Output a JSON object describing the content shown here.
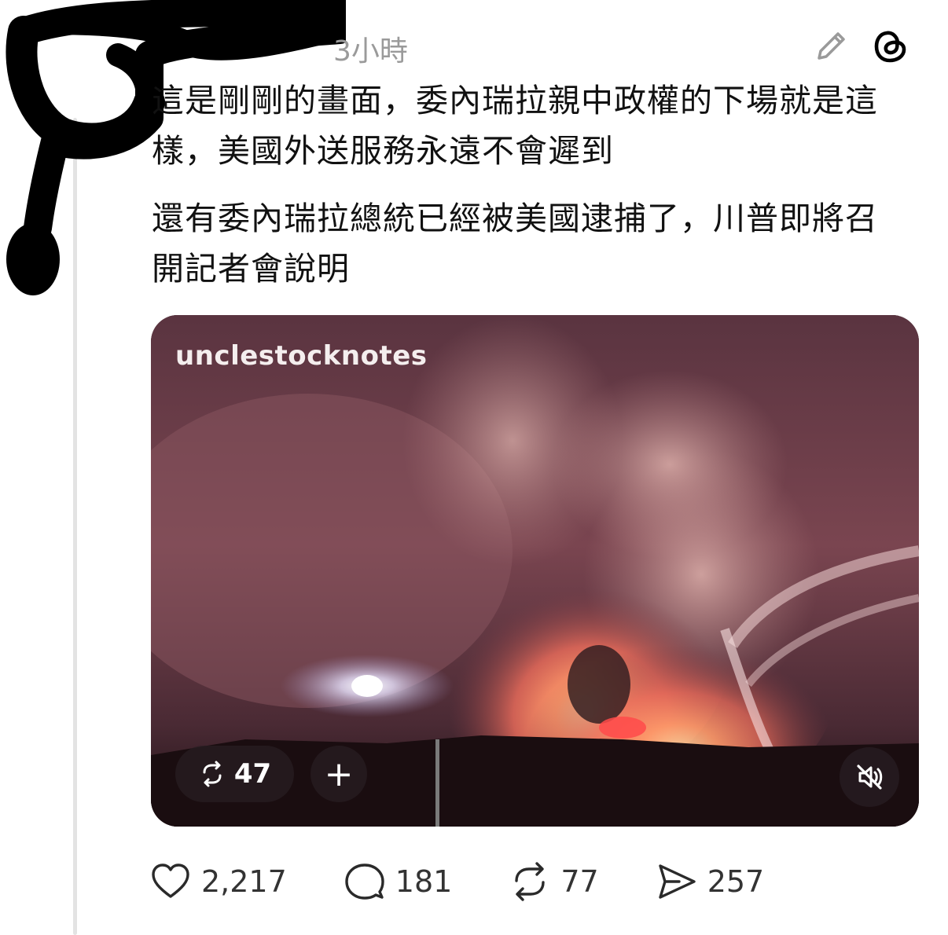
{
  "post": {
    "timestamp": "3小時",
    "paragraphs": [
      "這是剛剛的畫面，委內瑞拉親中政權的下場就是這樣，美國外送服務永遠不會遲到",
      "還有委內瑞拉總統已經被美國逮捕了，川普即將召開記者會說明"
    ]
  },
  "media": {
    "watermark": "unclestocknotes",
    "repost_count": "47",
    "add_label": "+"
  },
  "actions": {
    "likes": "2,217",
    "comments": "181",
    "reposts": "77",
    "shares": "257"
  },
  "colors": {
    "timestamp": "#9a9a9a",
    "thread_line": "#e3e3e3",
    "text": "#111111"
  },
  "icons": [
    "edit-icon",
    "threads-logo-icon",
    "repost-icon",
    "plus-icon",
    "mute-icon",
    "heart-icon",
    "comment-icon",
    "share-icon"
  ]
}
